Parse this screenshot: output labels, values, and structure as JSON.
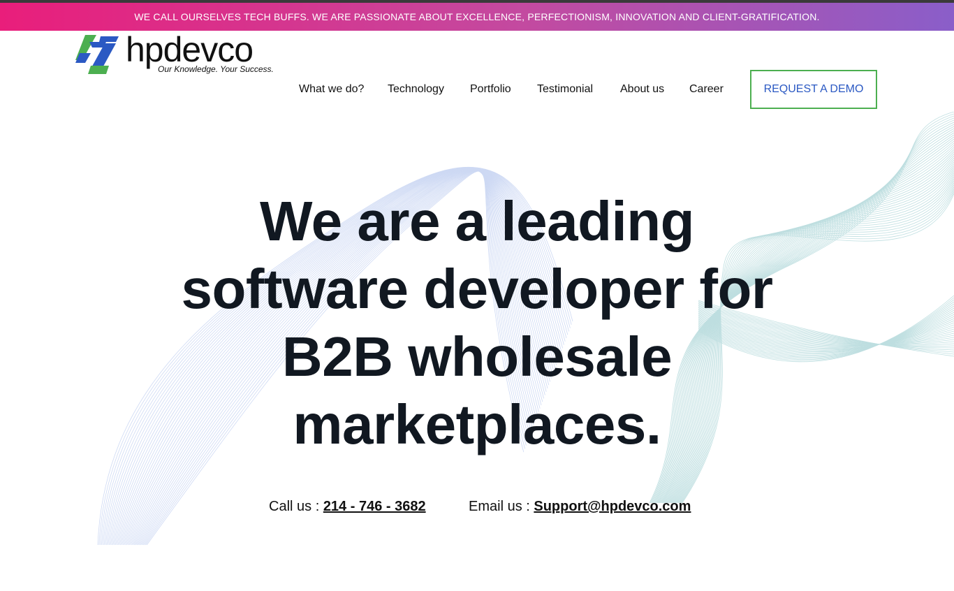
{
  "announcement": {
    "text": "WE CALL OURSELVES TECH BUFFS. WE ARE PASSIONATE ABOUT EXCELLENCE, PERFECTIONISM, INNOVATION AND CLIENT-GRATIFICATION."
  },
  "brand": {
    "name": "hpdevco",
    "tagline": "Our Knowledge. Your Success.",
    "colors": {
      "blue": "#2b59c3",
      "green": "#4caf50",
      "pink": "#e91e7b",
      "purple": "#8a5ec9"
    }
  },
  "nav": {
    "items": [
      {
        "label": "What we do?"
      },
      {
        "label": "Technology"
      },
      {
        "label": "Portfolio"
      },
      {
        "label": "Testimonial"
      },
      {
        "label": "About us"
      },
      {
        "label": "Career"
      }
    ],
    "cta_label": "REQUEST A DEMO"
  },
  "hero": {
    "line1": "We are a leading",
    "line2": "software developer for",
    "line3": "B2B wholesale",
    "line4": "marketplaces."
  },
  "contact": {
    "call_label": "Call us : ",
    "phone": "214 - 746 - 3682",
    "email_label": "Email us : ",
    "email": "Support@hpdevco.com"
  }
}
